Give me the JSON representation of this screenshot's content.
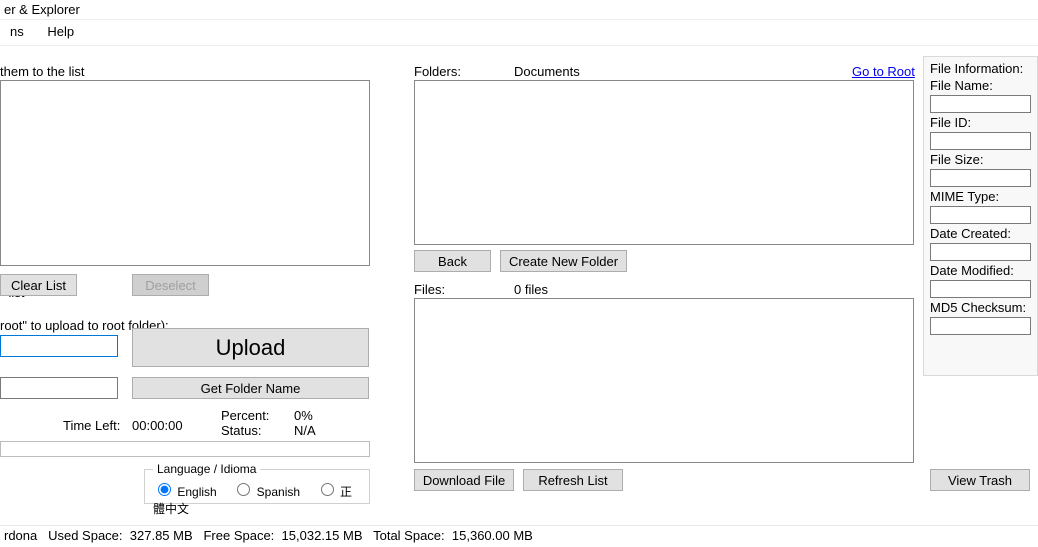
{
  "window": {
    "title_fragment": "er & Explorer"
  },
  "menu": {
    "item0_fragment": "ns",
    "help": "Help"
  },
  "left": {
    "drop_hint_fragment": "them to the list",
    "remove_from_list_fragment": "om list",
    "clear_list": "Clear List",
    "deselect": "Deselect",
    "folder_hint_fragment": "root\" to upload to root folder):",
    "upload": "Upload",
    "get_folder_name": "Get Folder Name",
    "time_left_label": "Time Left:",
    "time_left_value": "00:00:00",
    "percent_label": "Percent:",
    "percent_value": "0%",
    "status_label": "Status:",
    "status_value": "N/A"
  },
  "lang": {
    "legend": "Language / Idioma",
    "english": "English",
    "spanish": "Spanish",
    "chinese": "正體中文"
  },
  "mid": {
    "folders_label": "Folders:",
    "folders_current": "Documents",
    "go_to_root": "Go to Root",
    "back": "Back",
    "create_new_folder": "Create New Folder",
    "files_label": "Files:",
    "files_count": "0 files",
    "download_file": "Download File",
    "refresh_list": "Refresh List"
  },
  "info": {
    "heading": "File Information:",
    "file_name": "File Name:",
    "file_id": "File ID:",
    "file_size": "File Size:",
    "mime_type": "MIME Type:",
    "date_created": "Date Created:",
    "date_modified": "Date Modified:",
    "md5": "MD5 Checksum:",
    "view_trash": "View Trash"
  },
  "status": {
    "user_fragment": "rdona",
    "used_label": "Used Space:",
    "used_value": "327.85 MB",
    "free_label": "Free Space:",
    "free_value": "15,032.15 MB",
    "total_label": "Total Space:",
    "total_value": "15,360.00 MB"
  }
}
